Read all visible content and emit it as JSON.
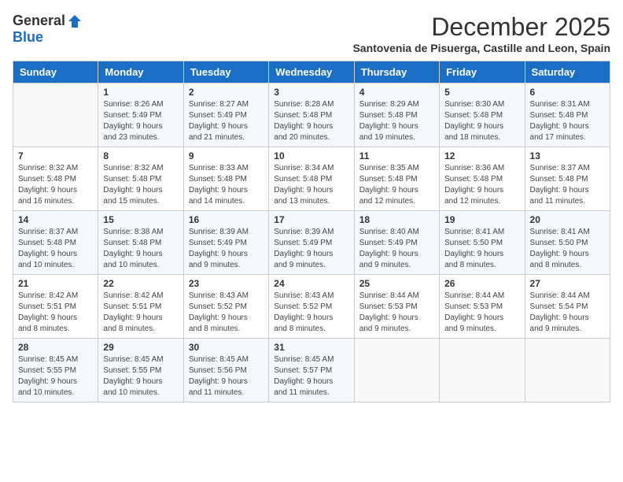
{
  "logo": {
    "general": "General",
    "blue": "Blue"
  },
  "title": "December 2025",
  "subtitle": "Santovenia de Pisuerga, Castille and Leon, Spain",
  "days_of_week": [
    "Sunday",
    "Monday",
    "Tuesday",
    "Wednesday",
    "Thursday",
    "Friday",
    "Saturday"
  ],
  "weeks": [
    [
      {
        "day": "",
        "info": ""
      },
      {
        "day": "1",
        "info": "Sunrise: 8:26 AM\nSunset: 5:49 PM\nDaylight: 9 hours\nand 23 minutes."
      },
      {
        "day": "2",
        "info": "Sunrise: 8:27 AM\nSunset: 5:49 PM\nDaylight: 9 hours\nand 21 minutes."
      },
      {
        "day": "3",
        "info": "Sunrise: 8:28 AM\nSunset: 5:48 PM\nDaylight: 9 hours\nand 20 minutes."
      },
      {
        "day": "4",
        "info": "Sunrise: 8:29 AM\nSunset: 5:48 PM\nDaylight: 9 hours\nand 19 minutes."
      },
      {
        "day": "5",
        "info": "Sunrise: 8:30 AM\nSunset: 5:48 PM\nDaylight: 9 hours\nand 18 minutes."
      },
      {
        "day": "6",
        "info": "Sunrise: 8:31 AM\nSunset: 5:48 PM\nDaylight: 9 hours\nand 17 minutes."
      }
    ],
    [
      {
        "day": "7",
        "info": "Sunrise: 8:32 AM\nSunset: 5:48 PM\nDaylight: 9 hours\nand 16 minutes."
      },
      {
        "day": "8",
        "info": "Sunrise: 8:32 AM\nSunset: 5:48 PM\nDaylight: 9 hours\nand 15 minutes."
      },
      {
        "day": "9",
        "info": "Sunrise: 8:33 AM\nSunset: 5:48 PM\nDaylight: 9 hours\nand 14 minutes."
      },
      {
        "day": "10",
        "info": "Sunrise: 8:34 AM\nSunset: 5:48 PM\nDaylight: 9 hours\nand 13 minutes."
      },
      {
        "day": "11",
        "info": "Sunrise: 8:35 AM\nSunset: 5:48 PM\nDaylight: 9 hours\nand 12 minutes."
      },
      {
        "day": "12",
        "info": "Sunrise: 8:36 AM\nSunset: 5:48 PM\nDaylight: 9 hours\nand 12 minutes."
      },
      {
        "day": "13",
        "info": "Sunrise: 8:37 AM\nSunset: 5:48 PM\nDaylight: 9 hours\nand 11 minutes."
      }
    ],
    [
      {
        "day": "14",
        "info": "Sunrise: 8:37 AM\nSunset: 5:48 PM\nDaylight: 9 hours\nand 10 minutes."
      },
      {
        "day": "15",
        "info": "Sunrise: 8:38 AM\nSunset: 5:48 PM\nDaylight: 9 hours\nand 10 minutes."
      },
      {
        "day": "16",
        "info": "Sunrise: 8:39 AM\nSunset: 5:49 PM\nDaylight: 9 hours\nand 9 minutes."
      },
      {
        "day": "17",
        "info": "Sunrise: 8:39 AM\nSunset: 5:49 PM\nDaylight: 9 hours\nand 9 minutes."
      },
      {
        "day": "18",
        "info": "Sunrise: 8:40 AM\nSunset: 5:49 PM\nDaylight: 9 hours\nand 9 minutes."
      },
      {
        "day": "19",
        "info": "Sunrise: 8:41 AM\nSunset: 5:50 PM\nDaylight: 9 hours\nand 8 minutes."
      },
      {
        "day": "20",
        "info": "Sunrise: 8:41 AM\nSunset: 5:50 PM\nDaylight: 9 hours\nand 8 minutes."
      }
    ],
    [
      {
        "day": "21",
        "info": "Sunrise: 8:42 AM\nSunset: 5:51 PM\nDaylight: 9 hours\nand 8 minutes."
      },
      {
        "day": "22",
        "info": "Sunrise: 8:42 AM\nSunset: 5:51 PM\nDaylight: 9 hours\nand 8 minutes."
      },
      {
        "day": "23",
        "info": "Sunrise: 8:43 AM\nSunset: 5:52 PM\nDaylight: 9 hours\nand 8 minutes."
      },
      {
        "day": "24",
        "info": "Sunrise: 8:43 AM\nSunset: 5:52 PM\nDaylight: 9 hours\nand 8 minutes."
      },
      {
        "day": "25",
        "info": "Sunrise: 8:44 AM\nSunset: 5:53 PM\nDaylight: 9 hours\nand 9 minutes."
      },
      {
        "day": "26",
        "info": "Sunrise: 8:44 AM\nSunset: 5:53 PM\nDaylight: 9 hours\nand 9 minutes."
      },
      {
        "day": "27",
        "info": "Sunrise: 8:44 AM\nSunset: 5:54 PM\nDaylight: 9 hours\nand 9 minutes."
      }
    ],
    [
      {
        "day": "28",
        "info": "Sunrise: 8:45 AM\nSunset: 5:55 PM\nDaylight: 9 hours\nand 10 minutes."
      },
      {
        "day": "29",
        "info": "Sunrise: 8:45 AM\nSunset: 5:55 PM\nDaylight: 9 hours\nand 10 minutes."
      },
      {
        "day": "30",
        "info": "Sunrise: 8:45 AM\nSunset: 5:56 PM\nDaylight: 9 hours\nand 11 minutes."
      },
      {
        "day": "31",
        "info": "Sunrise: 8:45 AM\nSunset: 5:57 PM\nDaylight: 9 hours\nand 11 minutes."
      },
      {
        "day": "",
        "info": ""
      },
      {
        "day": "",
        "info": ""
      },
      {
        "day": "",
        "info": ""
      }
    ]
  ]
}
